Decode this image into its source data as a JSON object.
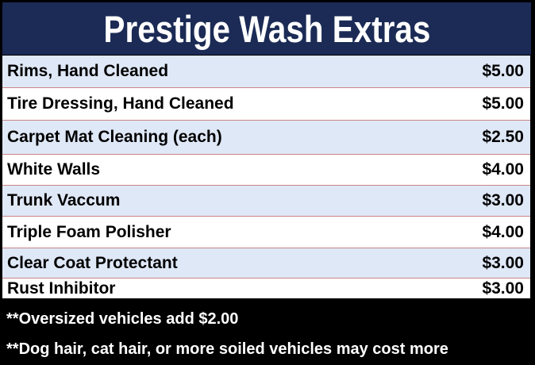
{
  "title": "Prestige Wash Extras",
  "items": [
    {
      "name": "Rims, Hand Cleaned",
      "price": "$5.00"
    },
    {
      "name": "Tire Dressing, Hand Cleaned",
      "price": "$5.00"
    },
    {
      "name": "Carpet Mat Cleaning (each)",
      "price": "$2.50"
    },
    {
      "name": "White Walls",
      "price": "$4.00"
    },
    {
      "name": "Trunk Vaccum",
      "price": "$3.00"
    },
    {
      "name": "Triple Foam Polisher",
      "price": "$4.00"
    },
    {
      "name": "Clear Coat Protectant",
      "price": "$3.00"
    },
    {
      "name": "Rust Inhibitor",
      "price": "$3.00"
    }
  ],
  "notes": [
    "**Oversized vehicles add $2.00",
    "**Dog hair, cat hair, or more soiled vehicles may cost more"
  ],
  "colors": {
    "title_background": "#1b2b55",
    "shaded_row": "#dfe8f7",
    "row_divider": "#c98585",
    "background": "#000000"
  }
}
